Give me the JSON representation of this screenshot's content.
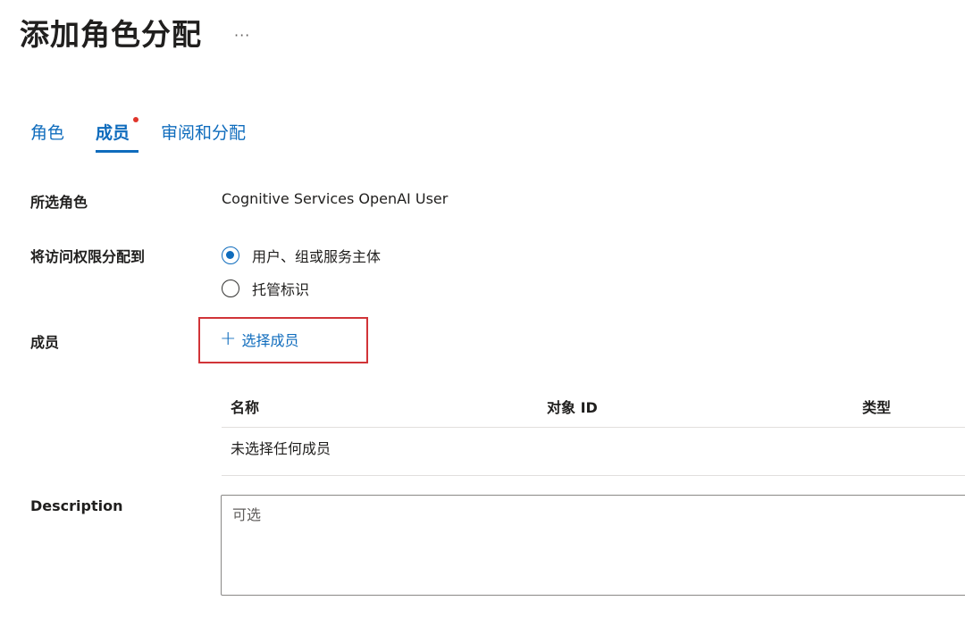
{
  "header": {
    "title": "添加角色分配",
    "more": "···"
  },
  "tabs": [
    {
      "label": "角色"
    },
    {
      "label": "成员"
    },
    {
      "label": "审阅和分配"
    }
  ],
  "form": {
    "selected_role_label": "所选角色",
    "selected_role_value": "Cognitive Services OpenAI User",
    "assign_to_label": "将访问权限分配到",
    "assign_options": [
      {
        "label": "用户、组或服务主体",
        "checked": true
      },
      {
        "label": "托管标识",
        "checked": false
      }
    ],
    "members_label": "成员",
    "select_members": "选择成员",
    "table": {
      "columns": [
        "名称",
        "对象 ID",
        "类型"
      ],
      "empty_text": "未选择任何成员"
    },
    "description_label": "Description",
    "description_placeholder": "可选"
  },
  "colors": {
    "accent": "#0f6cbd",
    "highlight_border": "#d13438",
    "tab_dot": "#e0352b"
  }
}
